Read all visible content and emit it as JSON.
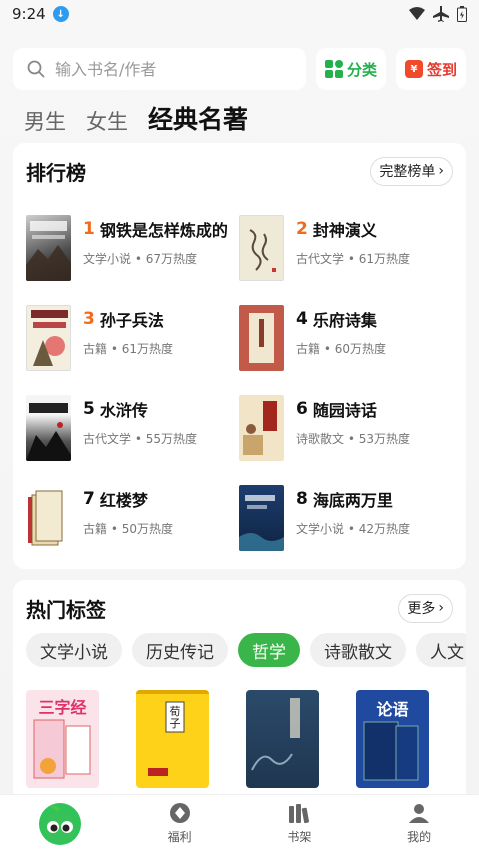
{
  "status": {
    "time": "9:24"
  },
  "search": {
    "placeholder": "输入书名/作者"
  },
  "actions": {
    "category_label": "分类",
    "signin_label": "签到"
  },
  "top_tabs": [
    "男生",
    "女生",
    "经典名著"
  ],
  "ranking": {
    "title": "排行榜",
    "full_list_label": "完整榜单",
    "items": [
      {
        "rank": "1",
        "title": "钢铁是怎样炼成的",
        "meta": "文学小说 • 67万热度"
      },
      {
        "rank": "2",
        "title": "封神演义",
        "meta": "古代文学 • 61万热度"
      },
      {
        "rank": "3",
        "title": "孙子兵法",
        "meta": "古籍 • 61万热度"
      },
      {
        "rank": "4",
        "title": "乐府诗集",
        "meta": "古籍 • 60万热度"
      },
      {
        "rank": "5",
        "title": "水浒传",
        "meta": "古代文学 • 55万热度"
      },
      {
        "rank": "6",
        "title": "随园诗话",
        "meta": "诗歌散文 • 53万热度"
      },
      {
        "rank": "7",
        "title": "红楼梦",
        "meta": "古籍 • 50万热度"
      },
      {
        "rank": "8",
        "title": "海底两万里",
        "meta": "文学小说 • 42万热度"
      }
    ]
  },
  "hot_tags": {
    "title": "热门标签",
    "more_label": "更多",
    "tags": [
      "文学小说",
      "历史传记",
      "哲学",
      "诗歌散文",
      "人文"
    ],
    "selected_tag": "哲学",
    "books": [
      "三字经",
      "荀子",
      "",
      "论语"
    ]
  },
  "bottom_nav": {
    "welfare": "福利",
    "shelf": "书架",
    "mine": "我的"
  },
  "colors": {
    "accent_green": "#3ab54a",
    "rank_orange": "#f26a1b",
    "sign_red": "#e53a2f"
  }
}
